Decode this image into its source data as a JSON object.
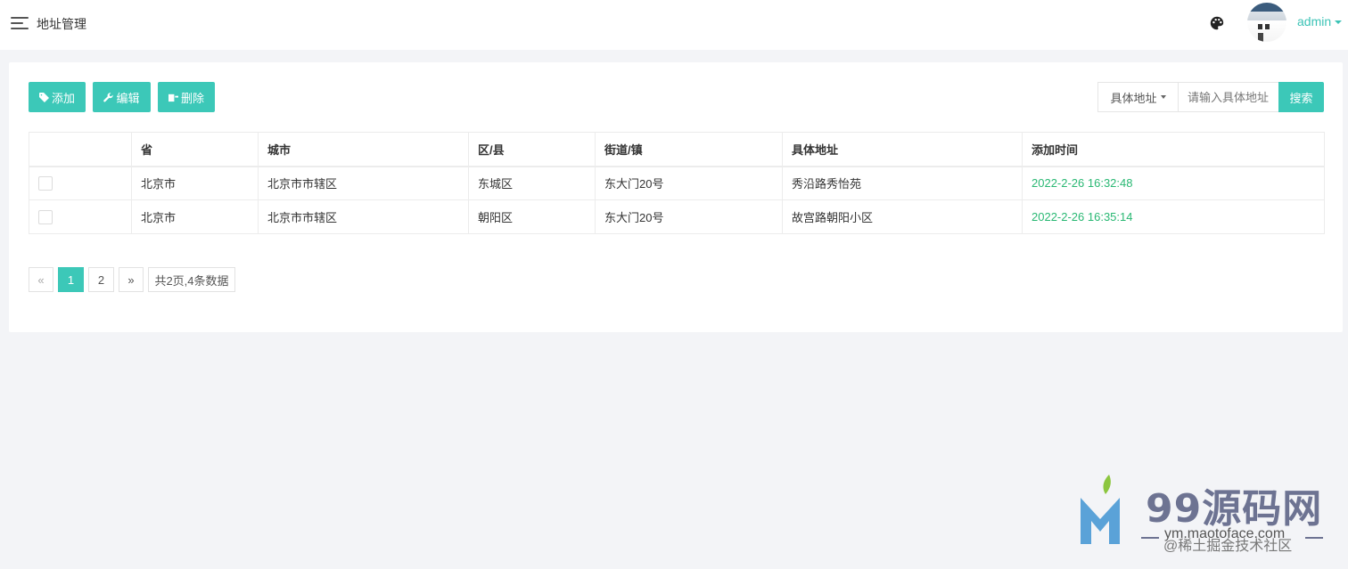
{
  "header": {
    "title": "地址管理",
    "username": "admin"
  },
  "toolbar": {
    "add_label": "添加",
    "edit_label": "编辑",
    "delete_label": "删除"
  },
  "search": {
    "field_selected": "具体地址",
    "placeholder": "请输入具体地址",
    "button_label": "搜索"
  },
  "table": {
    "columns": [
      "省",
      "城市",
      "区/县",
      "街道/镇",
      "具体地址",
      "添加时间"
    ],
    "rows": [
      {
        "province": "北京市",
        "city": "北京市市辖区",
        "district": "东城区",
        "street": "东大门20号",
        "address": "秀沿路秀怡苑",
        "added_at": "2022-2-26 16:32:48",
        "checked": false
      },
      {
        "province": "北京市",
        "city": "北京市市辖区",
        "district": "朝阳区",
        "street": "东大门20号",
        "address": "故宫路朝阳小区",
        "added_at": "2022-2-26 16:35:14",
        "checked": false
      }
    ]
  },
  "pagination": {
    "prev": "«",
    "pages": [
      "1",
      "2"
    ],
    "current_page": "1",
    "next": "»",
    "info": "共2页,4条数据"
  },
  "watermark": {
    "title": "99源码网",
    "url": "ym.maotoface.com",
    "credit": "@稀土掘金技术社区"
  },
  "colors": {
    "accent": "#3cc8b8",
    "time_text": "#29b873",
    "page_bg": "#f3f4f7"
  }
}
